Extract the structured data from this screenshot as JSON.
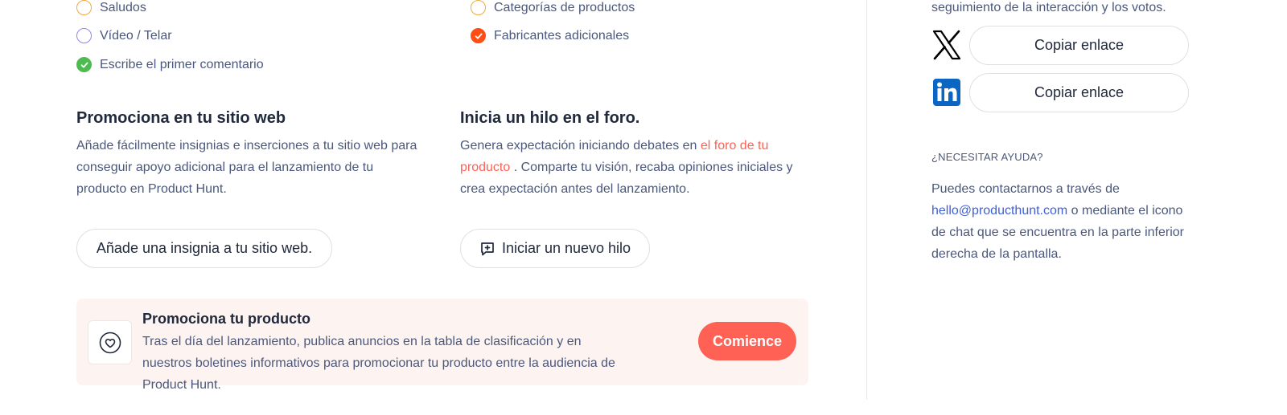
{
  "checklist": {
    "left": [
      {
        "label": "Saludos",
        "state": "pending",
        "color": "#f2a93b"
      },
      {
        "label": "Vídeo / Telar",
        "state": "pending",
        "color": "#8f86f4"
      },
      {
        "label": "Escribe el primer comentario",
        "state": "done",
        "color": "#4dbb4f"
      }
    ],
    "right": [
      {
        "label": "Categorías de productos",
        "state": "pending",
        "color": "#f2a93b"
      },
      {
        "label": "Fabricantes adicionales",
        "state": "done",
        "color": "#ff4d16"
      }
    ]
  },
  "website": {
    "title": "Promociona en tu sitio web",
    "text": "Añade fácilmente insignias e inserciones a tu sitio web para conseguir apoyo adicional para el lanzamiento de tu producto en Product Hunt.",
    "button": "Añade una insignia a tu sitio web."
  },
  "forum": {
    "title": "Inicia un hilo en el foro.",
    "text_before": "Genera expectación iniciando debates en ",
    "link": "el foro de tu producto",
    "text_after": " . Comparte tu visión, recaba opiniones iniciales y crea expectación antes del lanzamiento.",
    "button": "Iniciar un nuevo hilo",
    "button_icon": "message-plus-icon"
  },
  "promo": {
    "title": "Promociona tu producto",
    "text": "Tras el día del lanzamiento, publica anuncios en la tabla de clasificación y en nuestros boletines informativos para promocionar tu producto entre la audiencia de Product Hunt.",
    "button": "Comience",
    "icon": "heart-circle-icon",
    "accent": "#ff6154"
  },
  "sidebar": {
    "top_text": "seguimiento de la interacción y los votos.",
    "share": [
      {
        "network": "x-icon",
        "label": "Copiar enlace"
      },
      {
        "network": "linkedin-icon",
        "label": "Copiar enlace"
      }
    ],
    "help_heading": "¿NECESITAR AYUDA?",
    "help_before": "Puedes contactarnos a través de ",
    "help_email": "hello@producthunt.com",
    "help_after": " o mediante el icono de chat que se encuentra en la parte inferior derecha de la pantalla."
  }
}
